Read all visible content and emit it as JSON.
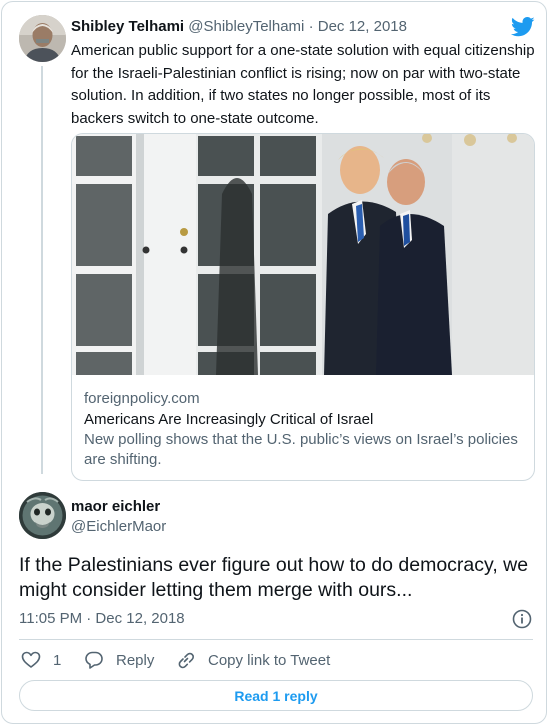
{
  "parent_tweet": {
    "author_name": "Shibley Telhami",
    "handle": "@ShibleyTelhami",
    "separator": "·",
    "date": "Dec 12, 2018",
    "text": "American public support for a one-state solution with equal citizenship for the Israeli-Palestinian conflict is rising; now on par with two-state solution. In addition, if two states no longer possible, most of its backers switch to one-state outcome.",
    "link_card": {
      "domain": "foreignpolicy.com",
      "title": "Americans Are Increasingly Critical of Israel",
      "description": "New polling shows that the U.S. public’s views on Israel’s policies are shifting."
    }
  },
  "reply": {
    "author_name": "maor eichler",
    "handle": "@EichlerMaor",
    "text": "If the Palestinians ever figure out how to do democracy, we might consider letting them merge with ours...",
    "timestamp": "11:05 PM · Dec 12, 2018"
  },
  "actions": {
    "like_count": "1",
    "reply_label": "Reply",
    "copy_link_label": "Copy link to Tweet"
  },
  "read_replies_label": "Read 1 reply",
  "icons": {
    "logo": "twitter-bird-icon",
    "info": "info-icon",
    "like": "heart-icon",
    "reply": "speech-bubble-icon",
    "copy_link": "link-icon"
  },
  "colors": {
    "accent": "#1d9bf0",
    "text": "#0f1419",
    "secondary_text": "#536471",
    "border": "#cfd9de"
  }
}
